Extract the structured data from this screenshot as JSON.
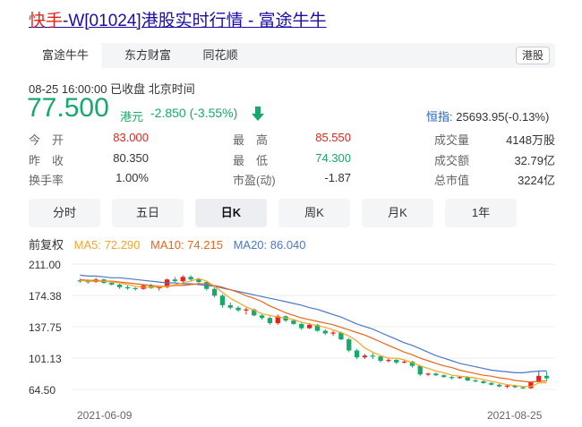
{
  "page": {
    "title_prefix": "快手",
    "title_rest": "-W[01024]港股实时行情 - 富途牛牛"
  },
  "tabs": [
    {
      "label": "富途牛牛",
      "active": true
    },
    {
      "label": "东方财富",
      "active": false
    },
    {
      "label": "同花顺",
      "active": false
    }
  ],
  "market_badge": "港股",
  "quote": {
    "time": "08-25 16:00:00",
    "status": "已收盘",
    "timezone": "北京时间",
    "price": "77.500",
    "currency": "港元",
    "change": "-2.850 (-3.55%)",
    "index_label": "恒指:",
    "index_value": "25693.95(-0.13%)"
  },
  "stats": [
    {
      "label": "今　开",
      "value": "83.000",
      "tone": "red"
    },
    {
      "label": "最　高",
      "value": "85.550",
      "tone": "red"
    },
    {
      "label": "成交量",
      "value": "4148万股",
      "tone": "dark"
    },
    {
      "label": "昨　收",
      "value": "80.350",
      "tone": "dark"
    },
    {
      "label": "最　低",
      "value": "74.300",
      "tone": "green"
    },
    {
      "label": "成交额",
      "value": "32.79亿",
      "tone": "dark"
    },
    {
      "label": "换手率",
      "value": "1.00%",
      "tone": "dark"
    },
    {
      "label": "市盈(动)",
      "value": "-1.87",
      "tone": "dark"
    },
    {
      "label": "总市值",
      "value": "3224亿",
      "tone": "dark"
    }
  ],
  "periods": [
    {
      "label": "分时",
      "active": false
    },
    {
      "label": "五日",
      "active": false
    },
    {
      "label": "日K",
      "active": true
    },
    {
      "label": "周K",
      "active": false
    },
    {
      "label": "月K",
      "active": false
    },
    {
      "label": "1年",
      "active": false
    }
  ],
  "indicators": {
    "adjust": "前复权",
    "ma5": "MA5: 72.290",
    "ma10": "MA10: 74.215",
    "ma20": "MA20: 86.040"
  },
  "colors": {
    "up": "#e2231a",
    "down": "#17a86b",
    "ma5": "#f5a623",
    "ma10": "#e8651b",
    "ma20": "#4a78c9"
  },
  "chart_data": {
    "type": "candlestick",
    "y_ticks": [
      "211.00",
      "174.38",
      "137.75",
      "101.13",
      "64.50"
    ],
    "y_tick_values": [
      211.0,
      174.38,
      137.75,
      101.13,
      64.5
    ],
    "x_ticks": [
      "2021-06-09",
      "2021-08-25"
    ],
    "ylim": [
      64.5,
      211.0
    ],
    "grid": true,
    "candles": [
      [
        192,
        194,
        189,
        191
      ],
      [
        191,
        193,
        188,
        190
      ],
      [
        190,
        195,
        189,
        193
      ],
      [
        193,
        194,
        188,
        189
      ],
      [
        189,
        191,
        186,
        187
      ],
      [
        187,
        188,
        182,
        184
      ],
      [
        184,
        186,
        181,
        183
      ],
      [
        183,
        184,
        180,
        182
      ],
      [
        182,
        187,
        181,
        186
      ],
      [
        186,
        188,
        182,
        183
      ],
      [
        183,
        185,
        180,
        184
      ],
      [
        184,
        194,
        183,
        193
      ],
      [
        193,
        196,
        190,
        191
      ],
      [
        191,
        198,
        189,
        196
      ],
      [
        196,
        198,
        191,
        193
      ],
      [
        193,
        195,
        188,
        190
      ],
      [
        190,
        191,
        180,
        182
      ],
      [
        182,
        184,
        172,
        174
      ],
      [
        174,
        176,
        160,
        163
      ],
      [
        163,
        166,
        158,
        160
      ],
      [
        160,
        162,
        155,
        157
      ],
      [
        157,
        160,
        152,
        158
      ],
      [
        158,
        159,
        150,
        151
      ],
      [
        151,
        153,
        146,
        148
      ],
      [
        148,
        150,
        140,
        142
      ],
      [
        142,
        152,
        140,
        150
      ],
      [
        150,
        151,
        143,
        145
      ],
      [
        145,
        147,
        140,
        141
      ],
      [
        141,
        143,
        134,
        136
      ],
      [
        136,
        142,
        135,
        140
      ],
      [
        140,
        141,
        132,
        133
      ],
      [
        133,
        135,
        128,
        130
      ],
      [
        130,
        133,
        127,
        131
      ],
      [
        131,
        132,
        122,
        123
      ],
      [
        123,
        125,
        108,
        110
      ],
      [
        110,
        112,
        100,
        102
      ],
      [
        102,
        106,
        100,
        104
      ],
      [
        104,
        107,
        100,
        103
      ],
      [
        103,
        104,
        96,
        98
      ],
      [
        98,
        101,
        96,
        99
      ],
      [
        99,
        100,
        94,
        96
      ],
      [
        96,
        99,
        95,
        97
      ],
      [
        97,
        98,
        90,
        92
      ],
      [
        92,
        93,
        80,
        82
      ],
      [
        82,
        84,
        80,
        83
      ],
      [
        83,
        84,
        80,
        81
      ],
      [
        81,
        82,
        78,
        79
      ],
      [
        79,
        80,
        76,
        78
      ],
      [
        78,
        80,
        77,
        79
      ],
      [
        79,
        80,
        74,
        75
      ],
      [
        75,
        77,
        73,
        74
      ],
      [
        74,
        75,
        71,
        72
      ],
      [
        72,
        73,
        69,
        70
      ],
      [
        70,
        71,
        67,
        68
      ],
      [
        68,
        70,
        66,
        69
      ],
      [
        69,
        70,
        66,
        67
      ],
      [
        67,
        68,
        65,
        66
      ],
      [
        66,
        74,
        65,
        73
      ],
      [
        73,
        85.55,
        74.3,
        80.35
      ],
      [
        80.35,
        85.55,
        74.3,
        77.5
      ]
    ],
    "ma5": [
      192,
      191,
      191,
      191,
      190,
      189,
      187,
      185,
      184,
      184,
      184,
      185,
      187,
      189,
      191,
      194,
      191,
      185,
      178,
      171,
      166,
      161,
      157,
      153,
      151,
      149,
      148,
      146,
      143,
      141,
      139,
      137,
      134,
      131,
      127,
      121,
      113,
      108,
      104,
      101,
      101,
      99,
      96,
      92,
      89,
      86,
      84,
      81,
      80,
      79,
      78,
      76,
      74,
      72,
      70,
      69,
      68,
      68,
      72,
      72.29
    ],
    "ma10": [
      193,
      192,
      192,
      191,
      191,
      190,
      189,
      188,
      187,
      186,
      185,
      185,
      186,
      186,
      187,
      188,
      188,
      186,
      184,
      181,
      178,
      174,
      171,
      167,
      162,
      158,
      154,
      151,
      148,
      146,
      144,
      142,
      140,
      137,
      134,
      131,
      128,
      124,
      120,
      116,
      112,
      108,
      105,
      101,
      98,
      95,
      92,
      90,
      87,
      85,
      83,
      81,
      80,
      78,
      77,
      75,
      74,
      73,
      74,
      74.215
    ],
    "ma20": [
      198,
      197,
      197,
      196,
      195,
      195,
      194,
      193,
      192,
      191,
      190,
      189,
      189,
      188,
      188,
      187,
      186,
      185,
      183,
      181,
      179,
      177,
      175,
      173,
      171,
      169,
      167,
      165,
      163,
      160,
      158,
      155,
      152,
      149,
      145,
      141,
      138,
      135,
      131,
      127,
      123,
      119,
      116,
      112,
      108,
      104,
      101,
      98,
      95,
      93,
      91,
      89,
      87,
      86,
      85,
      84,
      84,
      85,
      86,
      86.04
    ]
  }
}
